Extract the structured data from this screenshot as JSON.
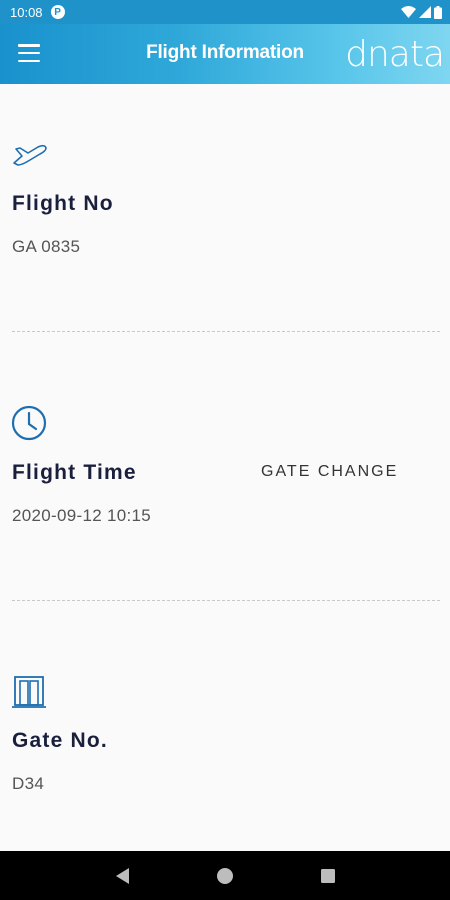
{
  "status_bar": {
    "time": "10:08",
    "notification_glyph": "P"
  },
  "app_bar": {
    "title": "Flight Information",
    "brand": "dnata"
  },
  "sections": [
    {
      "label": "Flight No",
      "value": "GA 0835",
      "icon": "airplane-icon"
    },
    {
      "label": "Flight Time",
      "value": "2020-09-12 10:15",
      "icon": "clock-icon",
      "badge": "GATE CHANGE"
    },
    {
      "label": "Gate No.",
      "value": "D34",
      "icon": "gate-door-icon"
    }
  ],
  "colors": {
    "accent": "#1f93c9",
    "icon": "#1e6fb0",
    "label": "#1a1f3c"
  }
}
